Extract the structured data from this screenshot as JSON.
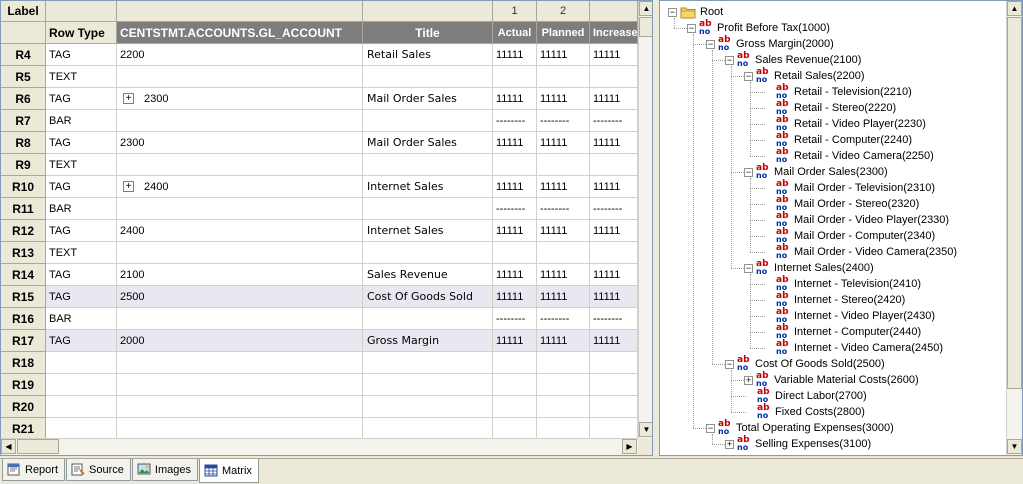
{
  "grid": {
    "top_header": {
      "label": "Label",
      "col_numbers": [
        "1",
        "2",
        ""
      ]
    },
    "main_header": {
      "row_type": "Row Type",
      "account": "CENTSTMT.ACCOUNTS.GL_ACCOUNT",
      "title": "Title",
      "actual": "Actual",
      "planned": "Planned",
      "increase": "Increase"
    },
    "rows": [
      {
        "label": "R4",
        "type": "TAG",
        "account": "2200",
        "expander": false,
        "title": "Retail Sales",
        "actual": "11111",
        "planned": "11111",
        "increase": "11111",
        "hl": false
      },
      {
        "label": "R5",
        "type": "TEXT",
        "account": "",
        "expander": false,
        "title": "",
        "actual": "",
        "planned": "",
        "increase": "",
        "hl": false
      },
      {
        "label": "R6",
        "type": "TAG",
        "account": "2300",
        "expander": true,
        "title": "Mail Order Sales",
        "actual": "11111",
        "planned": "11111",
        "increase": "11111",
        "hl": false
      },
      {
        "label": "R7",
        "type": "BAR",
        "account": "",
        "expander": false,
        "title": "",
        "actual": "--------",
        "planned": "--------",
        "increase": "--------",
        "hl": false
      },
      {
        "label": "R8",
        "type": "TAG",
        "account": "2300",
        "expander": false,
        "title": "Mail Order Sales",
        "actual": "11111",
        "planned": "11111",
        "increase": "11111",
        "hl": false
      },
      {
        "label": "R9",
        "type": "TEXT",
        "account": "",
        "expander": false,
        "title": "",
        "actual": "",
        "planned": "",
        "increase": "",
        "hl": false
      },
      {
        "label": "R10",
        "type": "TAG",
        "account": "2400",
        "expander": true,
        "title": "Internet Sales",
        "actual": "11111",
        "planned": "11111",
        "increase": "11111",
        "hl": false
      },
      {
        "label": "R11",
        "type": "BAR",
        "account": "",
        "expander": false,
        "title": "",
        "actual": "--------",
        "planned": "--------",
        "increase": "--------",
        "hl": false
      },
      {
        "label": "R12",
        "type": "TAG",
        "account": "2400",
        "expander": false,
        "title": "Internet Sales",
        "actual": "11111",
        "planned": "11111",
        "increase": "11111",
        "hl": false
      },
      {
        "label": "R13",
        "type": "TEXT",
        "account": "",
        "expander": false,
        "title": "",
        "actual": "",
        "planned": "",
        "increase": "",
        "hl": false
      },
      {
        "label": "R14",
        "type": "TAG",
        "account": "2100",
        "expander": false,
        "title": "Sales Revenue",
        "actual": "11111",
        "planned": "11111",
        "increase": "11111",
        "hl": false
      },
      {
        "label": "R15",
        "type": "TAG",
        "account": "2500",
        "expander": false,
        "title": "Cost Of Goods Sold",
        "actual": "11111",
        "planned": "11111",
        "increase": "11111",
        "hl": true
      },
      {
        "label": "R16",
        "type": "BAR",
        "account": "",
        "expander": false,
        "title": "",
        "actual": "--------",
        "planned": "--------",
        "increase": "--------",
        "hl": false
      },
      {
        "label": "R17",
        "type": "TAG",
        "account": "2000",
        "expander": false,
        "title": "Gross Margin",
        "actual": "11111",
        "planned": "11111",
        "increase": "11111",
        "hl": true
      },
      {
        "label": "R18",
        "type": "",
        "account": "",
        "expander": false,
        "title": "",
        "actual": "",
        "planned": "",
        "increase": "",
        "hl": false
      },
      {
        "label": "R19",
        "type": "",
        "account": "",
        "expander": false,
        "title": "",
        "actual": "",
        "planned": "",
        "increase": "",
        "hl": false
      },
      {
        "label": "R20",
        "type": "",
        "account": "",
        "expander": false,
        "title": "",
        "actual": "",
        "planned": "",
        "increase": "",
        "hl": false
      },
      {
        "label": "R21",
        "type": "",
        "account": "",
        "expander": false,
        "title": "",
        "actual": "",
        "planned": "",
        "increase": "",
        "hl": false
      }
    ]
  },
  "tree": {
    "nodes": [
      {
        "text": "Root",
        "depth": 0,
        "toggle": "-",
        "icon": "folder-icon"
      },
      {
        "text": "Profit Before Tax(1000)",
        "depth": 1,
        "toggle": "-",
        "icon": "ab-icon"
      },
      {
        "text": "Gross Margin(2000)",
        "depth": 2,
        "toggle": "-",
        "icon": "ab-icon"
      },
      {
        "text": "Sales Revenue(2100)",
        "depth": 3,
        "toggle": "-",
        "icon": "ab-icon"
      },
      {
        "text": "Retail Sales(2200)",
        "depth": 4,
        "toggle": "-",
        "icon": "ab-icon"
      },
      {
        "text": "Retail - Television(2210)",
        "depth": 5,
        "toggle": "",
        "icon": "ab-icon"
      },
      {
        "text": "Retail - Stereo(2220)",
        "depth": 5,
        "toggle": "",
        "icon": "ab-icon"
      },
      {
        "text": "Retail - Video Player(2230)",
        "depth": 5,
        "toggle": "",
        "icon": "ab-icon"
      },
      {
        "text": "Retail - Computer(2240)",
        "depth": 5,
        "toggle": "",
        "icon": "ab-icon"
      },
      {
        "text": "Retail - Video Camera(2250)",
        "depth": 5,
        "toggle": "",
        "icon": "ab-icon"
      },
      {
        "text": "Mail Order Sales(2300)",
        "depth": 4,
        "toggle": "-",
        "icon": "ab-icon"
      },
      {
        "text": "Mail Order - Television(2310)",
        "depth": 5,
        "toggle": "",
        "icon": "ab-icon"
      },
      {
        "text": "Mail Order - Stereo(2320)",
        "depth": 5,
        "toggle": "",
        "icon": "ab-icon"
      },
      {
        "text": "Mail Order - Video Player(2330)",
        "depth": 5,
        "toggle": "",
        "icon": "ab-icon"
      },
      {
        "text": "Mail Order - Computer(2340)",
        "depth": 5,
        "toggle": "",
        "icon": "ab-icon"
      },
      {
        "text": "Mail Order - Video Camera(2350)",
        "depth": 5,
        "toggle": "",
        "icon": "ab-icon"
      },
      {
        "text": "Internet Sales(2400)",
        "depth": 4,
        "toggle": "-",
        "icon": "ab-icon"
      },
      {
        "text": "Internet - Television(2410)",
        "depth": 5,
        "toggle": "",
        "icon": "ab-icon"
      },
      {
        "text": "Internet - Stereo(2420)",
        "depth": 5,
        "toggle": "",
        "icon": "ab-icon"
      },
      {
        "text": "Internet - Video Player(2430)",
        "depth": 5,
        "toggle": "",
        "icon": "ab-icon"
      },
      {
        "text": "Internet - Computer(2440)",
        "depth": 5,
        "toggle": "",
        "icon": "ab-icon"
      },
      {
        "text": "Internet - Video Camera(2450)",
        "depth": 5,
        "toggle": "",
        "icon": "ab-icon"
      },
      {
        "text": "Cost Of Goods Sold(2500)",
        "depth": 3,
        "toggle": "-",
        "icon": "ab-icon"
      },
      {
        "text": "Variable Material Costs(2600)",
        "depth": 4,
        "toggle": "+",
        "icon": "ab-icon"
      },
      {
        "text": "Direct Labor(2700)",
        "depth": 4,
        "toggle": "",
        "icon": "ab-icon"
      },
      {
        "text": "Fixed Costs(2800)",
        "depth": 4,
        "toggle": "",
        "icon": "ab-icon"
      },
      {
        "text": "Total Operating Expenses(3000)",
        "depth": 2,
        "toggle": "-",
        "icon": "ab-icon"
      },
      {
        "text": "Selling Expenses(3100)",
        "depth": 3,
        "toggle": "+",
        "icon": "ab-icon"
      }
    ]
  },
  "tabs": [
    {
      "label": "Report",
      "icon": "report-icon",
      "active": false
    },
    {
      "label": "Source",
      "icon": "source-icon",
      "active": false
    },
    {
      "label": "Images",
      "icon": "images-icon",
      "active": false
    },
    {
      "label": "Matrix",
      "icon": "matrix-icon",
      "active": true
    }
  ],
  "colors": {
    "header_dark": "#7d7d7d",
    "row_highlight": "#e8e8f0",
    "ab_red": "#c00000",
    "ab_blue": "#0030a0"
  }
}
